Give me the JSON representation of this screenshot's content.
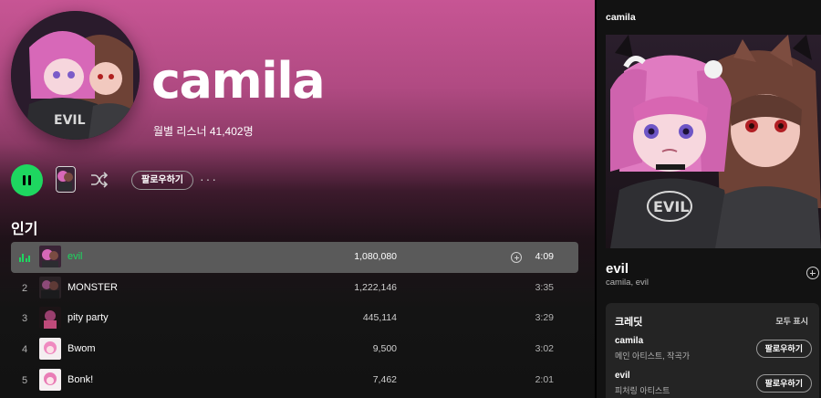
{
  "artist": {
    "name": "camila",
    "monthly_listeners": "월별 리스너 41,402명"
  },
  "controls": {
    "follow_label": "팔로우하기",
    "more_label": "···",
    "play_state": "playing"
  },
  "popular": {
    "title": "인기",
    "tracks": [
      {
        "num": "1",
        "title": "evil",
        "plays": "1,080,080",
        "duration": "4:09",
        "active": true
      },
      {
        "num": "2",
        "title": "MONSTER",
        "plays": "1,222,146",
        "duration": "3:35",
        "active": false
      },
      {
        "num": "3",
        "title": "pity party",
        "plays": "445,114",
        "duration": "3:29",
        "active": false
      },
      {
        "num": "4",
        "title": "Bwom",
        "plays": "9,500",
        "duration": "3:02",
        "active": false
      },
      {
        "num": "5",
        "title": "Bonk!",
        "plays": "7,462",
        "duration": "2:01",
        "active": false
      }
    ]
  },
  "now_playing": {
    "panel_title": "camila",
    "song": "evil",
    "artists": "camila, evil",
    "credits": {
      "title": "크레딧",
      "show_all": "모두 표시",
      "people": [
        {
          "name": "camila",
          "role": "메인 아티스트, 작곡가",
          "follow_label": "팔로우하기"
        },
        {
          "name": "evil",
          "role": "피처링 아티스트",
          "follow_label": "팔로우하기"
        }
      ]
    }
  },
  "colors": {
    "accent": "#1ed760",
    "header_pink": "#c75594",
    "background": "#121212"
  }
}
